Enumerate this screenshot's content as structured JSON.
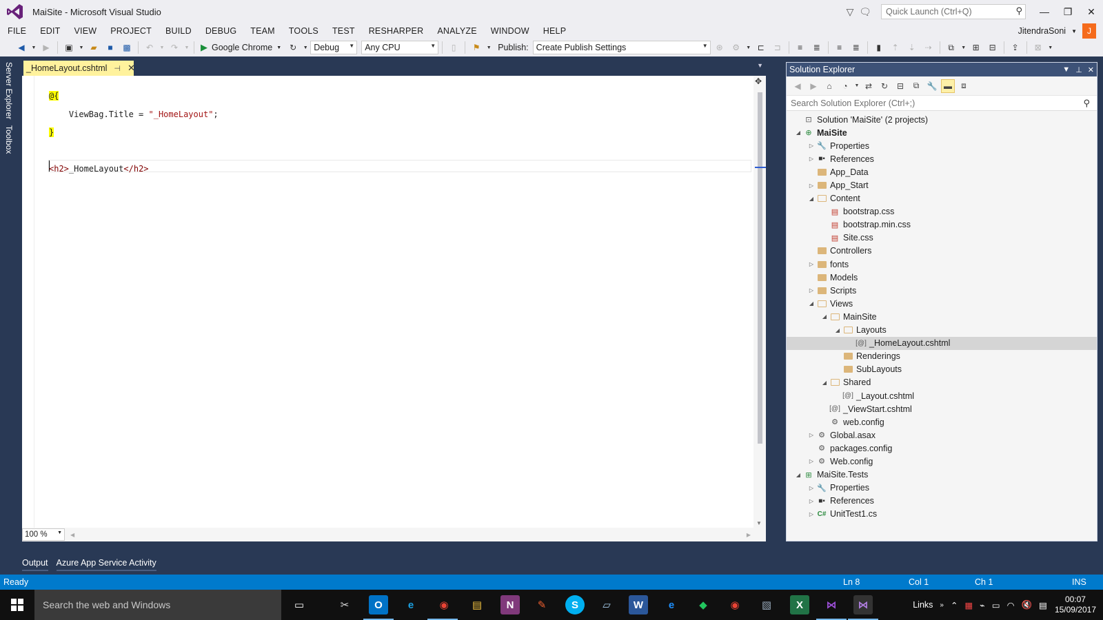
{
  "window": {
    "title": "MaiSite - Microsoft Visual Studio",
    "quick_launch_placeholder": "Quick Launch (Ctrl+Q)"
  },
  "menu": [
    "FILE",
    "EDIT",
    "VIEW",
    "PROJECT",
    "BUILD",
    "DEBUG",
    "TEAM",
    "TOOLS",
    "TEST",
    "RESHARPER",
    "ANALYZE",
    "WINDOW",
    "HELP"
  ],
  "user": {
    "name": "JitendraSoni",
    "initial": "J"
  },
  "toolbar": {
    "run_target": "Google Chrome",
    "configuration": "Debug",
    "platform": "Any CPU",
    "publish_label": "Publish:",
    "publish_profile": "Create Publish Settings"
  },
  "side_tabs": [
    "Server Explorer",
    "Toolbox"
  ],
  "editor": {
    "tab_label": "_HomeLayout.cshtml",
    "zoom": "100 %",
    "code": {
      "razor_open": "@{",
      "line2_prop": "ViewBag.Title = ",
      "line2_str": "\"_HomeLayout\"",
      "line2_end": ";",
      "razor_close": "}",
      "h2_open": "<h2>",
      "h2_text": "_HomeLayout",
      "h2_close": "</h2>"
    }
  },
  "solution_explorer": {
    "title": "Solution Explorer",
    "search_placeholder": "Search Solution Explorer (Ctrl+;)",
    "tree": [
      {
        "label": "Solution 'MaiSite' (2 projects)",
        "depth": 0,
        "arrow": "",
        "icon": "solution"
      },
      {
        "label": "MaiSite",
        "depth": 0,
        "arrow": "open",
        "icon": "project",
        "bold": true
      },
      {
        "label": "Properties",
        "depth": 1,
        "arrow": "closed",
        "icon": "wrench"
      },
      {
        "label": "References",
        "depth": 1,
        "arrow": "closed",
        "icon": "references"
      },
      {
        "label": "App_Data",
        "depth": 1,
        "arrow": "",
        "icon": "folder"
      },
      {
        "label": "App_Start",
        "depth": 1,
        "arrow": "closed",
        "icon": "folder"
      },
      {
        "label": "Content",
        "depth": 1,
        "arrow": "open",
        "icon": "folder-open"
      },
      {
        "label": "bootstrap.css",
        "depth": 2,
        "arrow": "",
        "icon": "css"
      },
      {
        "label": "bootstrap.min.css",
        "depth": 2,
        "arrow": "",
        "icon": "css"
      },
      {
        "label": "Site.css",
        "depth": 2,
        "arrow": "",
        "icon": "css"
      },
      {
        "label": "Controllers",
        "depth": 1,
        "arrow": "",
        "icon": "folder"
      },
      {
        "label": "fonts",
        "depth": 1,
        "arrow": "closed",
        "icon": "folder"
      },
      {
        "label": "Models",
        "depth": 1,
        "arrow": "",
        "icon": "folder"
      },
      {
        "label": "Scripts",
        "depth": 1,
        "arrow": "closed",
        "icon": "folder"
      },
      {
        "label": "Views",
        "depth": 1,
        "arrow": "open",
        "icon": "folder-open"
      },
      {
        "label": "MainSite",
        "depth": 2,
        "arrow": "open",
        "icon": "folder-open"
      },
      {
        "label": "Layouts",
        "depth": 3,
        "arrow": "open",
        "icon": "folder-open"
      },
      {
        "label": "_HomeLayout.cshtml",
        "depth": 4,
        "arrow": "",
        "icon": "razor",
        "selected": true
      },
      {
        "label": "Renderings",
        "depth": 3,
        "arrow": "",
        "icon": "folder"
      },
      {
        "label": "SubLayouts",
        "depth": 3,
        "arrow": "",
        "icon": "folder"
      },
      {
        "label": "Shared",
        "depth": 2,
        "arrow": "open",
        "icon": "folder-open"
      },
      {
        "label": "_Layout.cshtml",
        "depth": 3,
        "arrow": "",
        "icon": "razor"
      },
      {
        "label": "_ViewStart.cshtml",
        "depth": 2,
        "arrow": "",
        "icon": "razor"
      },
      {
        "label": "web.config",
        "depth": 2,
        "arrow": "",
        "icon": "config"
      },
      {
        "label": "Global.asax",
        "depth": 1,
        "arrow": "closed",
        "icon": "config"
      },
      {
        "label": "packages.config",
        "depth": 1,
        "arrow": "",
        "icon": "config"
      },
      {
        "label": "Web.config",
        "depth": 1,
        "arrow": "closed",
        "icon": "config"
      },
      {
        "label": "MaiSite.Tests",
        "depth": 0,
        "arrow": "open",
        "icon": "test-project"
      },
      {
        "label": "Properties",
        "depth": 1,
        "arrow": "closed",
        "icon": "wrench"
      },
      {
        "label": "References",
        "depth": 1,
        "arrow": "closed",
        "icon": "references"
      },
      {
        "label": "UnitTest1.cs",
        "depth": 1,
        "arrow": "closed",
        "icon": "csharp"
      }
    ]
  },
  "bottom_tabs": [
    "Output",
    "Azure App Service Activity"
  ],
  "status": {
    "state": "Ready",
    "line": "Ln 8",
    "col": "Col 1",
    "ch": "Ch 1",
    "mode": "INS"
  },
  "taskbar": {
    "search_placeholder": "Search the web and Windows",
    "links_label": "Links",
    "time": "00:07",
    "date": "15/09/2017"
  },
  "colors": {
    "accent": "#007acc",
    "chrome": "#293955",
    "tab_active": "#fff29d",
    "panel_header": "#3d5277"
  }
}
